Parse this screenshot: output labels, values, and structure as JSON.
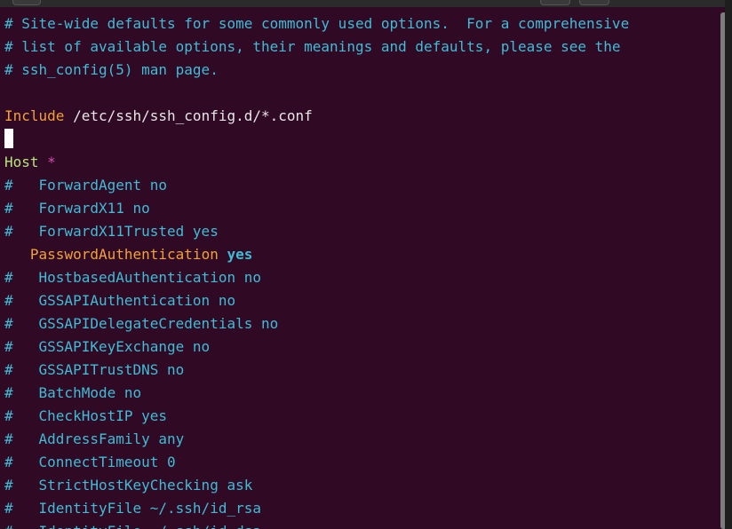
{
  "terminal": {
    "lines": [
      {
        "type": "comment",
        "text": "# Site-wide defaults for some commonly used options.  For a comprehensive"
      },
      {
        "type": "comment",
        "text": "# list of available options, their meanings and defaults, please see the"
      },
      {
        "type": "comment",
        "text": "# ssh_config(5) man page."
      },
      {
        "type": "blank",
        "text": ""
      },
      {
        "type": "include",
        "keyword": "Include",
        "value": " /etc/ssh/ssh_config.d/*.conf"
      },
      {
        "type": "cursor",
        "text": ""
      },
      {
        "type": "host",
        "keyword": "Host",
        "value": " *"
      },
      {
        "type": "comment",
        "text": "#   ForwardAgent no"
      },
      {
        "type": "comment",
        "text": "#   ForwardX11 no"
      },
      {
        "type": "comment",
        "text": "#   ForwardX11Trusted yes"
      },
      {
        "type": "option",
        "indent": "   ",
        "keyword": "PasswordAuthentication",
        "value": "yes"
      },
      {
        "type": "comment",
        "text": "#   HostbasedAuthentication no"
      },
      {
        "type": "comment",
        "text": "#   GSSAPIAuthentication no"
      },
      {
        "type": "comment",
        "text": "#   GSSAPIDelegateCredentials no"
      },
      {
        "type": "comment",
        "text": "#   GSSAPIKeyExchange no"
      },
      {
        "type": "comment",
        "text": "#   GSSAPITrustDNS no"
      },
      {
        "type": "comment",
        "text": "#   BatchMode no"
      },
      {
        "type": "comment",
        "text": "#   CheckHostIP yes"
      },
      {
        "type": "comment",
        "text": "#   AddressFamily any"
      },
      {
        "type": "comment",
        "text": "#   ConnectTimeout 0"
      },
      {
        "type": "comment",
        "text": "#   StrictHostKeyChecking ask"
      },
      {
        "type": "comment",
        "text": "#   IdentityFile ~/.ssh/id_rsa"
      },
      {
        "type": "comment",
        "text": "#   IdentityFile ~/.ssh/id_dsa"
      }
    ]
  },
  "colors": {
    "background": "#300a24",
    "comment": "#3fbcd6",
    "keyword": "#f2a03a",
    "host": "#b5e37e",
    "star": "#d44cb4",
    "value": "#3fbcd6"
  }
}
